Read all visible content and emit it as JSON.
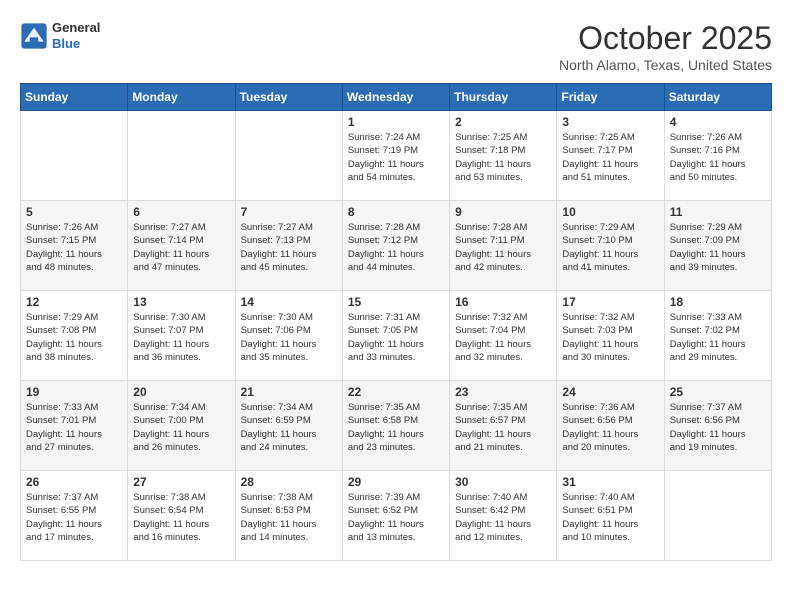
{
  "header": {
    "logo_line1": "General",
    "logo_line2": "Blue",
    "month": "October 2025",
    "location": "North Alamo, Texas, United States"
  },
  "weekdays": [
    "Sunday",
    "Monday",
    "Tuesday",
    "Wednesday",
    "Thursday",
    "Friday",
    "Saturday"
  ],
  "weeks": [
    [
      {
        "day": "",
        "info": ""
      },
      {
        "day": "",
        "info": ""
      },
      {
        "day": "",
        "info": ""
      },
      {
        "day": "1",
        "info": "Sunrise: 7:24 AM\nSunset: 7:19 PM\nDaylight: 11 hours\nand 54 minutes."
      },
      {
        "day": "2",
        "info": "Sunrise: 7:25 AM\nSunset: 7:18 PM\nDaylight: 11 hours\nand 53 minutes."
      },
      {
        "day": "3",
        "info": "Sunrise: 7:25 AM\nSunset: 7:17 PM\nDaylight: 11 hours\nand 51 minutes."
      },
      {
        "day": "4",
        "info": "Sunrise: 7:26 AM\nSunset: 7:16 PM\nDaylight: 11 hours\nand 50 minutes."
      }
    ],
    [
      {
        "day": "5",
        "info": "Sunrise: 7:26 AM\nSunset: 7:15 PM\nDaylight: 11 hours\nand 48 minutes."
      },
      {
        "day": "6",
        "info": "Sunrise: 7:27 AM\nSunset: 7:14 PM\nDaylight: 11 hours\nand 47 minutes."
      },
      {
        "day": "7",
        "info": "Sunrise: 7:27 AM\nSunset: 7:13 PM\nDaylight: 11 hours\nand 45 minutes."
      },
      {
        "day": "8",
        "info": "Sunrise: 7:28 AM\nSunset: 7:12 PM\nDaylight: 11 hours\nand 44 minutes."
      },
      {
        "day": "9",
        "info": "Sunrise: 7:28 AM\nSunset: 7:11 PM\nDaylight: 11 hours\nand 42 minutes."
      },
      {
        "day": "10",
        "info": "Sunrise: 7:29 AM\nSunset: 7:10 PM\nDaylight: 11 hours\nand 41 minutes."
      },
      {
        "day": "11",
        "info": "Sunrise: 7:29 AM\nSunset: 7:09 PM\nDaylight: 11 hours\nand 39 minutes."
      }
    ],
    [
      {
        "day": "12",
        "info": "Sunrise: 7:29 AM\nSunset: 7:08 PM\nDaylight: 11 hours\nand 38 minutes."
      },
      {
        "day": "13",
        "info": "Sunrise: 7:30 AM\nSunset: 7:07 PM\nDaylight: 11 hours\nand 36 minutes."
      },
      {
        "day": "14",
        "info": "Sunrise: 7:30 AM\nSunset: 7:06 PM\nDaylight: 11 hours\nand 35 minutes."
      },
      {
        "day": "15",
        "info": "Sunrise: 7:31 AM\nSunset: 7:05 PM\nDaylight: 11 hours\nand 33 minutes."
      },
      {
        "day": "16",
        "info": "Sunrise: 7:32 AM\nSunset: 7:04 PM\nDaylight: 11 hours\nand 32 minutes."
      },
      {
        "day": "17",
        "info": "Sunrise: 7:32 AM\nSunset: 7:03 PM\nDaylight: 11 hours\nand 30 minutes."
      },
      {
        "day": "18",
        "info": "Sunrise: 7:33 AM\nSunset: 7:02 PM\nDaylight: 11 hours\nand 29 minutes."
      }
    ],
    [
      {
        "day": "19",
        "info": "Sunrise: 7:33 AM\nSunset: 7:01 PM\nDaylight: 11 hours\nand 27 minutes."
      },
      {
        "day": "20",
        "info": "Sunrise: 7:34 AM\nSunset: 7:00 PM\nDaylight: 11 hours\nand 26 minutes."
      },
      {
        "day": "21",
        "info": "Sunrise: 7:34 AM\nSunset: 6:59 PM\nDaylight: 11 hours\nand 24 minutes."
      },
      {
        "day": "22",
        "info": "Sunrise: 7:35 AM\nSunset: 6:58 PM\nDaylight: 11 hours\nand 23 minutes."
      },
      {
        "day": "23",
        "info": "Sunrise: 7:35 AM\nSunset: 6:57 PM\nDaylight: 11 hours\nand 21 minutes."
      },
      {
        "day": "24",
        "info": "Sunrise: 7:36 AM\nSunset: 6:56 PM\nDaylight: 11 hours\nand 20 minutes."
      },
      {
        "day": "25",
        "info": "Sunrise: 7:37 AM\nSunset: 6:56 PM\nDaylight: 11 hours\nand 19 minutes."
      }
    ],
    [
      {
        "day": "26",
        "info": "Sunrise: 7:37 AM\nSunset: 6:55 PM\nDaylight: 11 hours\nand 17 minutes."
      },
      {
        "day": "27",
        "info": "Sunrise: 7:38 AM\nSunset: 6:54 PM\nDaylight: 11 hours\nand 16 minutes."
      },
      {
        "day": "28",
        "info": "Sunrise: 7:38 AM\nSunset: 6:53 PM\nDaylight: 11 hours\nand 14 minutes."
      },
      {
        "day": "29",
        "info": "Sunrise: 7:39 AM\nSunset: 6:52 PM\nDaylight: 11 hours\nand 13 minutes."
      },
      {
        "day": "30",
        "info": "Sunrise: 7:40 AM\nSunset: 6:42 PM\nDaylight: 11 hours\nand 12 minutes."
      },
      {
        "day": "31",
        "info": "Sunrise: 7:40 AM\nSunset: 6:51 PM\nDaylight: 11 hours\nand 10 minutes."
      },
      {
        "day": "",
        "info": ""
      }
    ]
  ]
}
